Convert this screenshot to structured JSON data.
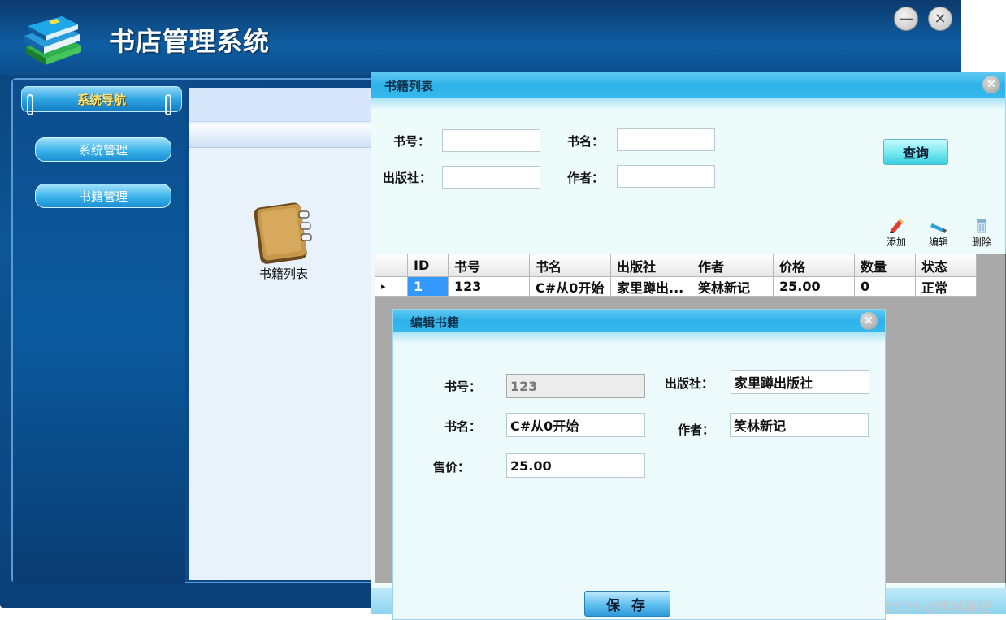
{
  "app": {
    "title": "书店管理系统",
    "minimize_glyph": "—",
    "close_glyph": "✕"
  },
  "nav": {
    "title": "系统导航",
    "items": [
      {
        "label": "系统管理"
      },
      {
        "label": "书籍管理"
      }
    ]
  },
  "desktop": {
    "icon_label": "书籍列表",
    "icon": "book-icon"
  },
  "book_list": {
    "title": "书籍列表",
    "close_glyph": "✕",
    "filters": {
      "book_no_label": "书号：",
      "name_label": "书名：",
      "publisher_label": "出版社：",
      "author_label": "作者：",
      "book_no_value": "",
      "name_value": "",
      "publisher_value": "",
      "author_value": ""
    },
    "search_label": "查询",
    "toolbar": {
      "add_label": "添加",
      "edit_label": "编辑",
      "delete_label": "删除"
    },
    "columns": [
      "ID",
      "书号",
      "书名",
      "出版社",
      "作者",
      "价格",
      "数量",
      "状态"
    ],
    "rows": [
      [
        "1",
        "123",
        "C#从0开始",
        "家里蹲出...",
        "笑林新记",
        "25.00",
        "0",
        "正常"
      ]
    ],
    "row_indicator": "▸"
  },
  "edit_book": {
    "title": "编辑书籍",
    "close_glyph": "✕",
    "book_no_label": "书号：",
    "book_no_value": "123",
    "publisher_label": "出版社：",
    "publisher_value": "家里蹲出版社",
    "name_label": "书名：",
    "name_value": "C#从0开始",
    "author_label": "作者：",
    "author_value": "笑林新记",
    "price_label": "售价：",
    "price_value": "25.00",
    "save_label": "保 存"
  },
  "watermark": "CSDN @笑林新记"
}
